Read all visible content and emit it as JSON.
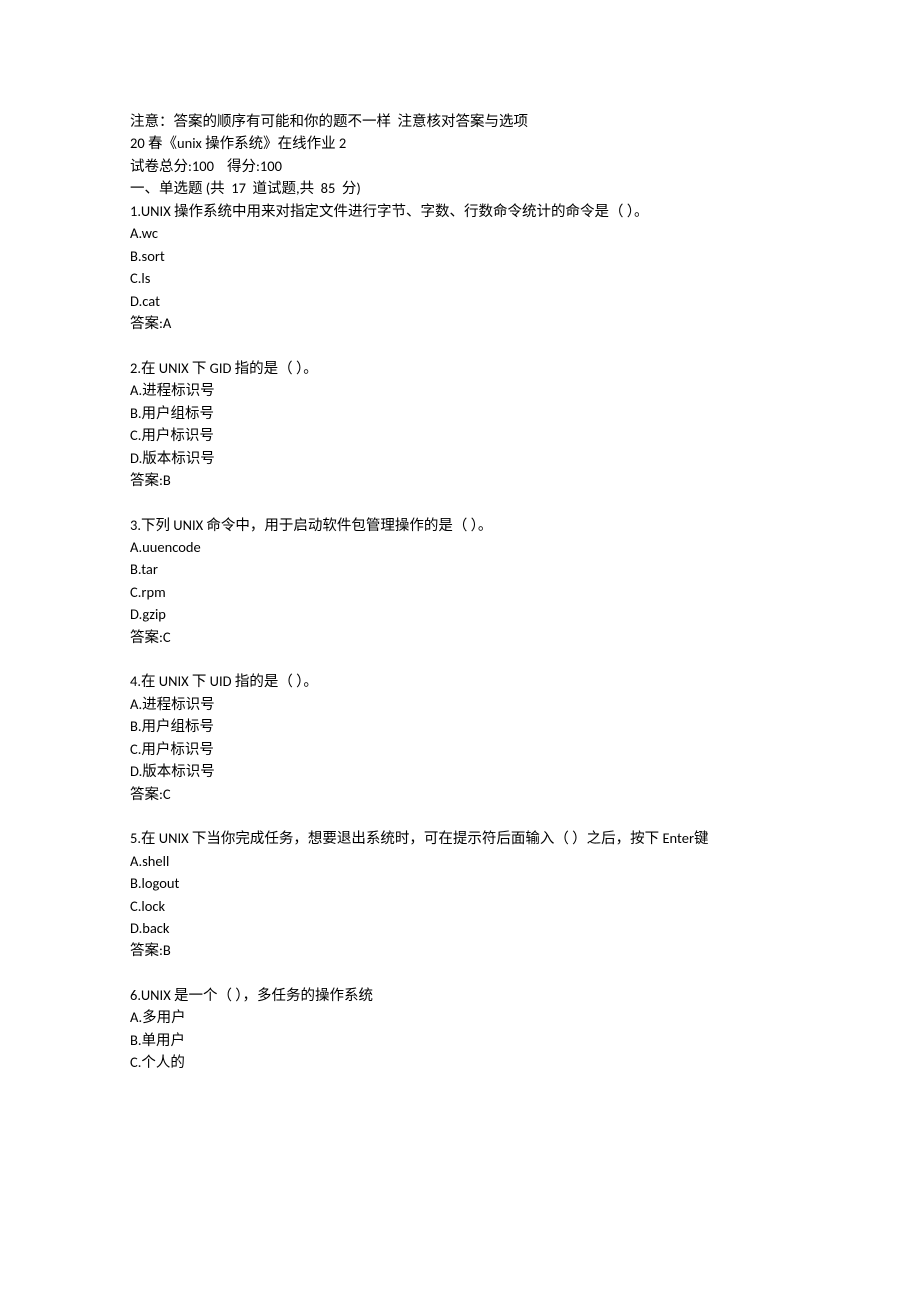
{
  "header": {
    "notice": "注意：答案的顺序有可能和你的题不一样  注意核对答案与选项",
    "title": "20 春《unix 操作系统》在线作业 2",
    "score_line": "试卷总分:100    得分:100",
    "section_heading": "一、单选题 (共  17  道试题,共  85  分)"
  },
  "questions": [
    {
      "stem": "1.UNIX 操作系统中用来对指定文件进行字节、字数、行数命令统计的命令是（ ）。",
      "options": [
        "A.wc",
        "B.sort",
        "C.ls",
        "D.cat"
      ],
      "answer": "答案:A"
    },
    {
      "stem": "2.在 UNIX 下 GID 指的是（ ）。",
      "options": [
        "A.进程标识号",
        "B.用户组标号",
        "C.用户标识号",
        "D.版本标识号"
      ],
      "answer": "答案:B"
    },
    {
      "stem": "3.下列 UNIX 命令中，用于启动软件包管理操作的是（ ）。",
      "options": [
        "A.uuencode",
        "B.tar",
        "C.rpm",
        "D.gzip"
      ],
      "answer": "答案:C"
    },
    {
      "stem": "4.在 UNIX 下 UID 指的是（ ）。",
      "options": [
        "A.进程标识号",
        "B.用户组标号",
        "C.用户标识号",
        "D.版本标识号"
      ],
      "answer": "答案:C"
    },
    {
      "stem": "5.在 UNIX 下当你完成任务，想要退出系统时，可在提示符后面输入（ ）之后，按下 Enter键",
      "options": [
        "A.shell",
        "B.logout",
        "C.lock",
        "D.back"
      ],
      "answer": "答案:B"
    },
    {
      "stem": "6.UNIX 是一个（ ），多任务的操作系统",
      "options": [
        "A.多用户",
        "B.单用户",
        "C.个人的"
      ],
      "answer": null
    }
  ]
}
